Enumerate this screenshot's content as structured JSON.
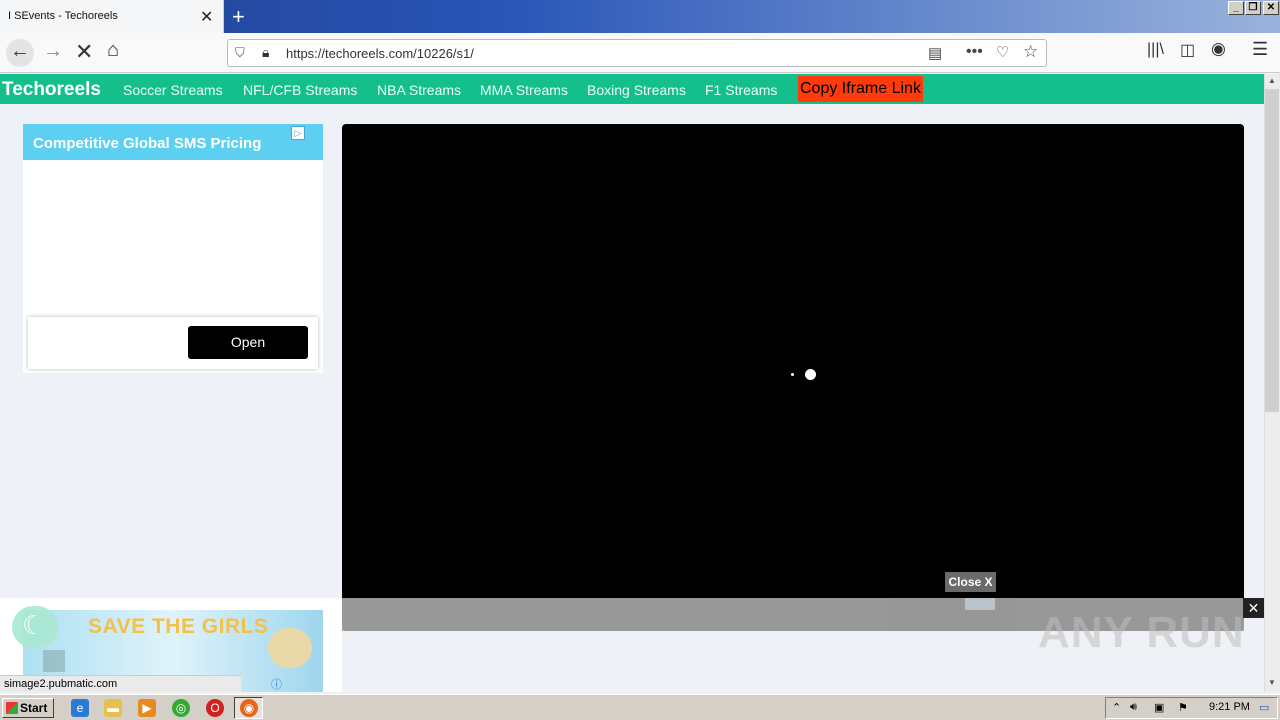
{
  "browser": {
    "tab_title": "I SEvents - Techoreels",
    "tab_close": "✕",
    "new_tab": "+",
    "url": "https://techoreels.com/10226/s1/",
    "status_url": "simage2.pubmatic.com"
  },
  "site": {
    "brand": "Techoreels",
    "nav": [
      "Soccer Streams",
      "NFL/CFB Streams",
      "NBA Streams",
      "MMA Streams",
      "Boxing Streams",
      "F1 Streams"
    ],
    "copy_link": "Copy Iframe Link"
  },
  "ad": {
    "headline": "Competitive Global SMS Pricing",
    "open_label": "Open",
    "banner_text": "SAVE THE GIRLS"
  },
  "player": {
    "close_label": "Close X",
    "dismiss": "✕"
  },
  "watermark": "ANY RUN",
  "taskbar": {
    "start": "Start",
    "clock": "9:21 PM"
  },
  "colors": {
    "site_nav": "#14bf8c",
    "copy_link_bg": "#ff3b0b",
    "ad_header": "#5dcff0"
  }
}
